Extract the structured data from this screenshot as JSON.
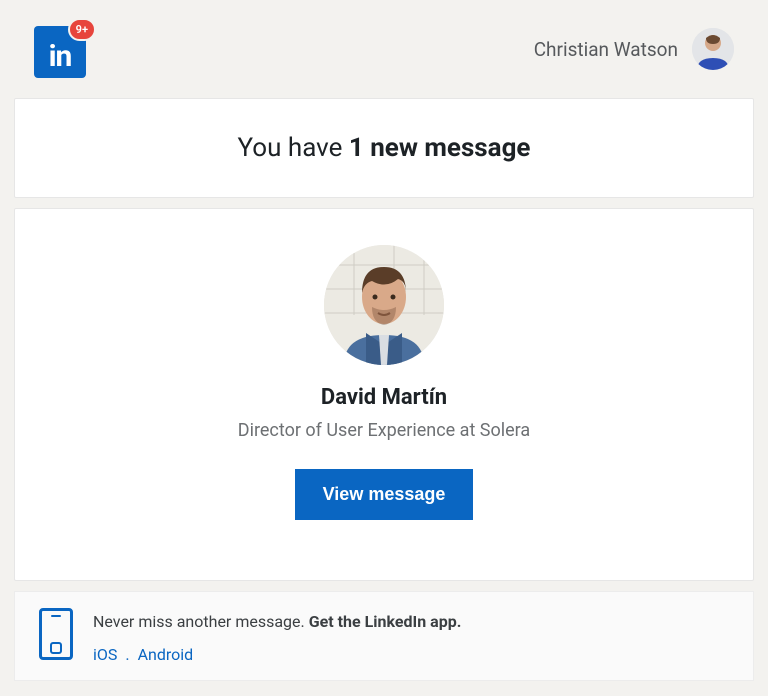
{
  "header": {
    "logo_text": "in",
    "badge_count": "9+",
    "user_name": "Christian Watson"
  },
  "headline": {
    "prefix": "You have ",
    "bold": "1 new message"
  },
  "message": {
    "sender_name": "David Martín",
    "sender_title": "Director of User Experience at Solera",
    "cta_label": "View message"
  },
  "promo": {
    "text_prefix": "Never miss another message. ",
    "text_bold": "Get the LinkedIn app.",
    "link_ios": "iOS",
    "link_sep": " . ",
    "link_android": "Android"
  }
}
